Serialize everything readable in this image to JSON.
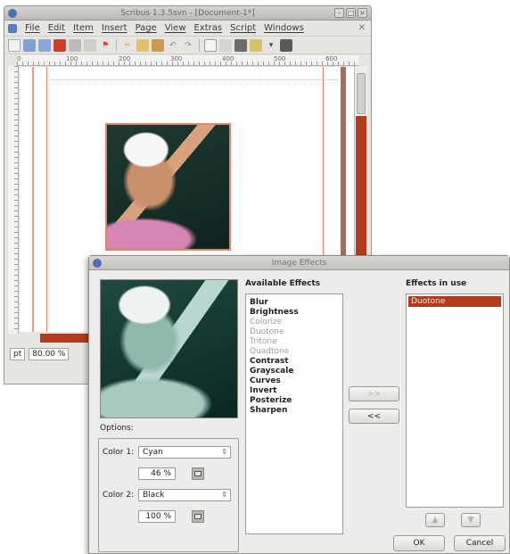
{
  "main_window": {
    "title": "Scribus 1.3.5svn - [Document-1*]",
    "menu": [
      "File",
      "Edit",
      "Item",
      "Insert",
      "Page",
      "View",
      "Extras",
      "Script",
      "Windows"
    ],
    "ruler_labels": [
      "0",
      "100",
      "200",
      "300",
      "400",
      "500",
      "600"
    ],
    "status": {
      "unit": "pt",
      "zoom": "80.00 %"
    }
  },
  "dialog": {
    "title": "Image Effects",
    "available_label": "Available Effects",
    "available_effects": [
      {
        "label": "Blur",
        "enabled": true
      },
      {
        "label": "Brightness",
        "enabled": true
      },
      {
        "label": "Colorize",
        "enabled": false
      },
      {
        "label": "Duotone",
        "enabled": false
      },
      {
        "label": "Tritone",
        "enabled": false
      },
      {
        "label": "Quadtone",
        "enabled": false
      },
      {
        "label": "Contrast",
        "enabled": true
      },
      {
        "label": "Grayscale",
        "enabled": true
      },
      {
        "label": "Curves",
        "enabled": true
      },
      {
        "label": "Invert",
        "enabled": true
      },
      {
        "label": "Posterize",
        "enabled": true
      },
      {
        "label": "Sharpen",
        "enabled": true
      }
    ],
    "in_use_label": "Effects in use",
    "in_use": [
      "Duotone"
    ],
    "add_button": ">>",
    "remove_button": "<<",
    "options_label": "Options:",
    "color1_label": "Color 1:",
    "color1_value": "Cyan",
    "color1_shade": "46 %",
    "color2_label": "Color 2:",
    "color2_value": "Black",
    "color2_shade": "100 %",
    "ok_button": "OK",
    "cancel_button": "Cancel"
  },
  "colors": {
    "accent": "#b33a1a",
    "frame": "#e2836a"
  }
}
